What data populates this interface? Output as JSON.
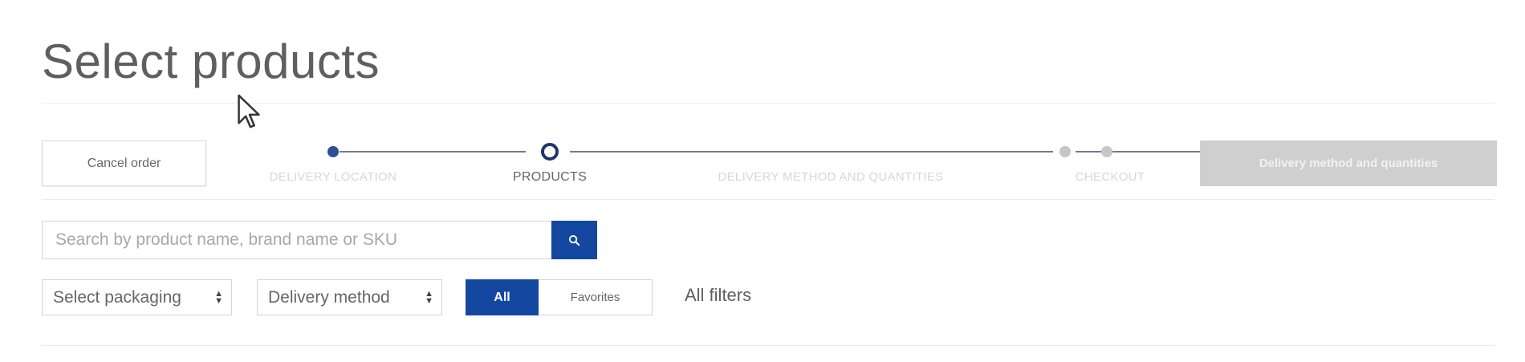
{
  "page": {
    "title": "Select products"
  },
  "toolbar": {
    "cancel_label": "Cancel order",
    "next_label": "Delivery method and quantities"
  },
  "steps": [
    {
      "label": "DELIVERY LOCATION",
      "state": "done"
    },
    {
      "label": "PRODUCTS",
      "state": "current"
    },
    {
      "label": "DELIVERY METHOD AND QUANTITIES",
      "state": "pending"
    },
    {
      "label": "CHECKOUT",
      "state": "pending"
    }
  ],
  "search": {
    "placeholder": "Search by product name, brand name or SKU",
    "value": "",
    "icon": "search-icon"
  },
  "filters": {
    "packaging": {
      "selected": "Select packaging",
      "icon": "select-arrows-icon"
    },
    "delivery_method": {
      "selected": "Delivery method",
      "icon": "select-arrows-icon"
    },
    "toggle": {
      "all_label": "All",
      "favorites_label": "Favorites",
      "active": "All"
    },
    "all_filters_label": "All filters"
  },
  "colors": {
    "primary": "#1447a0",
    "disabled_button": "#cfcfcf",
    "step_done": "#2e4f96",
    "step_current_ring": "#1f3668",
    "step_pending": "#c6c6c6"
  }
}
